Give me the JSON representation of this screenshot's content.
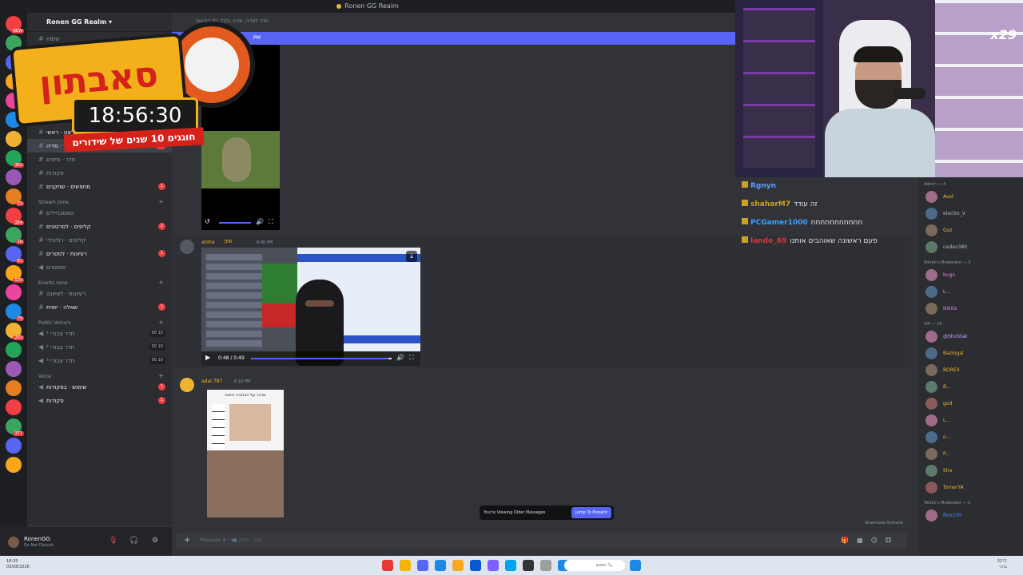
{
  "window": {
    "title": "Ronen GG Realm"
  },
  "server": {
    "name": "Ronen GG Realm"
  },
  "server_badges": [
    "NEW",
    "",
    "",
    "",
    "",
    "",
    "",
    "362",
    "",
    "53",
    "184",
    "16",
    "61",
    "520",
    "",
    "79",
    "203",
    "",
    "",
    "",
    "",
    "377",
    "",
    ""
  ],
  "channels": {
    "top_items": [
      {
        "label": "nitro",
        "type": "text"
      },
      {
        "label": "Live",
        "type": "cat"
      },
      {
        "label": "חברי מועדון",
        "type": "voice"
      },
      {
        "label": "בי\"ב",
        "type": "voice"
      },
      {
        "label": "המתנה",
        "type": "voice",
        "count": "3"
      },
      {
        "label": "אמונג אס",
        "type": "voice"
      }
    ],
    "chats_cat": "Chats",
    "chats": [
      {
        "label": "צ'אט · ראשי",
        "count": "31"
      },
      {
        "label": "חדר · מדיה",
        "count": "16",
        "active": true
      },
      {
        "label": "חדר · מימים"
      },
      {
        "label": "פקודות"
      },
      {
        "label": "מחפשים · שחקנים",
        "count": "1"
      }
    ],
    "stream_cat": "Stream zone",
    "stream": [
      {
        "label": "טאמבניילים"
      },
      {
        "label": "קליפים · לסרטונים",
        "count": "2"
      },
      {
        "label": "קליפים · רולטליי"
      },
      {
        "label": "רעיונות · לסטרים",
        "count": "1"
      },
      {
        "label": "סטאפים",
        "voice": true
      }
    ],
    "events_cat": "Events zone",
    "events": [
      {
        "label": "רעיונות · לאיוונט"
      },
      {
        "label": "שאלה · יומית",
        "count": "1"
      }
    ],
    "public_cat": "Public Voice's",
    "public": [
      {
        "label": "חדר צבורי ¹",
        "vc": "00 10"
      },
      {
        "label": "חדר צבורי ²",
        "vc": "00 10"
      },
      {
        "label": "חדר צבורי ³",
        "vc": "00 10"
      }
    ],
    "voice_cat": "Voice",
    "voice": [
      {
        "label": "שימוש · בפקודות",
        "count": "1"
      },
      {
        "label": "פקודות",
        "count": "1"
      }
    ]
  },
  "user": {
    "name": "RonenGG",
    "status": "Do Not Disturb"
  },
  "chat": {
    "header_text": "חדר לפדיה, מדיה בלבד בלי הודעות",
    "banner": "PM",
    "msg1": {
      "author": "aloha",
      "tag": "JEW",
      "time": "6:06 PM",
      "video_time": "0:48 / 0:49"
    },
    "msg2": {
      "author": "adar.787",
      "time": "6:10 PM",
      "caption": "מדבר על הבחורה הזאת"
    },
    "older_notice": "You're Viewing Older Messages",
    "jump_button": "Jump To Present",
    "composer_placeholder": "Message # | 📹 חדר · מדיה",
    "slowmode": "Slowmode Immune"
  },
  "overlay": {
    "title": "סאבתון",
    "timer": "18:56:30",
    "subtitle": "חוגגים 10 שנים של שידורים"
  },
  "webcam": {
    "multiplier": "x29"
  },
  "twitch_chat": [
    {
      "user": "Rgnyn",
      "text": "",
      "color": "#5c9cff"
    },
    {
      "user": "shaharM7",
      "text": "זה עודד",
      "color": "#c9a227"
    },
    {
      "user": "PCGamer1000",
      "text": "חחחחחחחחחחח",
      "color": "#3aa0ff"
    },
    {
      "user": "lando_69",
      "text": "פעם ראשונה שאוהבים אותנו",
      "color": "#d33a3a"
    }
  ],
  "members": {
    "admin_header": "Admin — 4",
    "admins": [
      {
        "name": "Avet",
        "color": "#f0b232"
      },
      {
        "name": "electro_V",
        "color": "#b5bac1"
      },
      {
        "name": "Goz",
        "color": "#f0b232"
      },
      {
        "name": "nadav380",
        "color": "#b5bac1"
      }
    ],
    "mod_header": "Ronen's Moderator — 3",
    "mods": [
      {
        "name": "bugo",
        "color": "#e67ee5"
      },
      {
        "name": "L...",
        "color": "#b5bac1"
      },
      {
        "name": "Nikita",
        "color": "#e67ee5"
      }
    ],
    "vip_header": "VIP — 10",
    "vips": [
      {
        "name": "@ShoStak",
        "color": "#c9a2ff"
      },
      {
        "name": "Bazingal",
        "color": "#f0b232"
      },
      {
        "name": "BOREX",
        "color": "#f0b232"
      },
      {
        "name": "B...",
        "color": "#f0b232"
      },
      {
        "name": "god",
        "color": "#f0b232"
      },
      {
        "name": "L...",
        "color": "#f0b232"
      },
      {
        "name": "o...",
        "color": "#f0b232"
      },
      {
        "name": "P...",
        "color": "#f0b232"
      },
      {
        "name": "Sho",
        "color": "#f0b232"
      },
      {
        "name": "TomerYA",
        "color": "#f0b232"
      }
    ],
    "twitch_mod_header": "Twitch's Moderator — 1",
    "twitch_mods": [
      {
        "name": "Ron100",
        "color": "#4d8bff"
      }
    ]
  },
  "taskbar": {
    "time": "18:35",
    "date": "03/08/2026",
    "search": "חיפוש",
    "temp": "31°C",
    "weather": "בהיר"
  },
  "colors": {
    "accent": "#5865f2",
    "bg": "#313338",
    "sidebar": "#2b2d31",
    "overlay_orange": "#f3b01b",
    "overlay_red": "#d4221a"
  }
}
